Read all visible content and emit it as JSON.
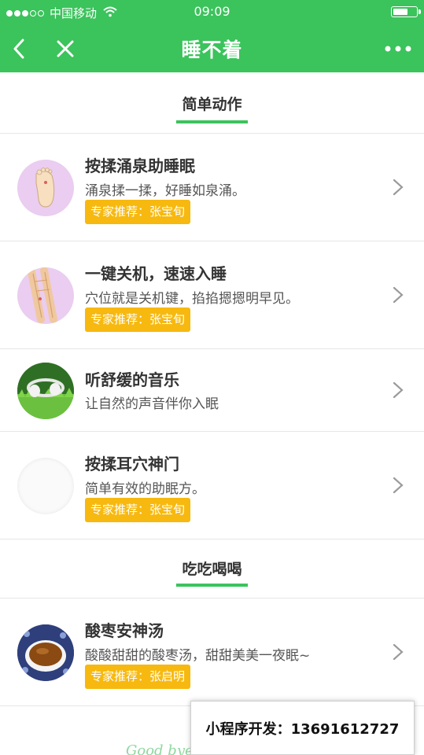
{
  "status_bar": {
    "carrier": "中国移动",
    "time": "09:09",
    "signal_icon": "signal-dots-icon",
    "wifi_icon": "wifi-icon",
    "battery_icon": "battery-icon"
  },
  "nav": {
    "title": "睡不着",
    "back_icon": "back-arrow-icon",
    "close_icon": "close-icon",
    "more_icon": "more-dots-icon",
    "bg_color": "#3bc35c"
  },
  "sections": [
    {
      "title": "简单动作",
      "items": [
        {
          "title": "按揉涌泉助睡眠",
          "desc": "涌泉揉一揉，好睡如泉涌。",
          "badge": "专家推荐：张宝旬",
          "image": "foot-illustration"
        },
        {
          "title": "一键关机，速速入睡",
          "desc": "穴位就是关机键，掐掐摁摁明早见。",
          "badge": "专家推荐：张宝旬",
          "image": "arm-bones-illustration"
        },
        {
          "title": "听舒缓的音乐",
          "desc": "让自然的声音伴你入眠",
          "image": "headphones-on-grass-photo"
        },
        {
          "title": "按揉耳穴神门",
          "desc": "简单有效的助眠方。",
          "badge": "专家推荐：张宝旬",
          "image": "blank-circle"
        }
      ]
    },
    {
      "title": "吃吃喝喝",
      "items": [
        {
          "title": "酸枣安神汤",
          "desc": "酸酸甜甜的酸枣汤，甜甜美美一夜眠~",
          "badge": "专家推荐：张启明",
          "image": "tea-cup-photo"
        }
      ]
    }
  ],
  "overlay_banner": {
    "text": "小程序开发：13691612727"
  },
  "footer_hint": "Good bye~ 祝您好睡眠~",
  "colors": {
    "accent": "#3bc35c",
    "badge": "#f7b90f",
    "divider": "#e6e6e6"
  }
}
